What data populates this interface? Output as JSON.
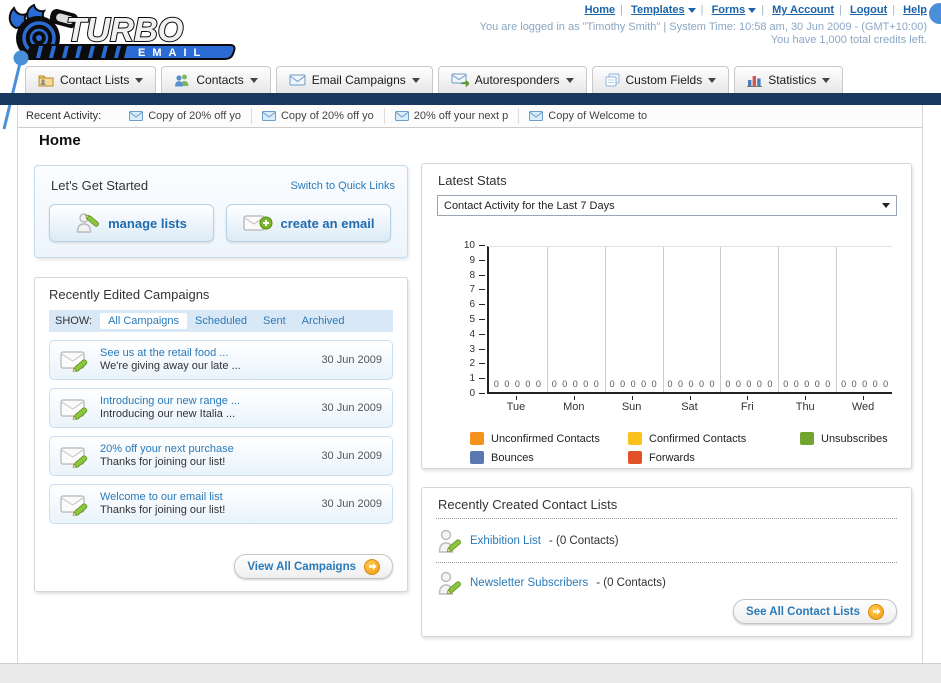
{
  "brand": {
    "name": "TURBO",
    "sub": "EMAIL"
  },
  "header": {
    "links": [
      {
        "label": "Home",
        "dropdown": false
      },
      {
        "label": "Templates",
        "dropdown": true
      },
      {
        "label": "Forms",
        "dropdown": true
      },
      {
        "label": "My Account",
        "dropdown": false
      },
      {
        "label": "Logout",
        "dropdown": false
      },
      {
        "label": "Help",
        "dropdown": false
      }
    ],
    "login_info": "You are logged in as \"Timothy Smith\" | System Time: 10:58 am, 30 Jun 2009 - (GMT+10:00)",
    "credits_info": "You have 1,000 total credits left."
  },
  "nav_tabs": [
    {
      "label": "Contact Lists"
    },
    {
      "label": "Contacts"
    },
    {
      "label": "Email Campaigns"
    },
    {
      "label": "Autoresponders"
    },
    {
      "label": "Custom Fields"
    },
    {
      "label": "Statistics"
    }
  ],
  "recent_activity": {
    "label": "Recent Activity:",
    "items": [
      "Copy of 20% off yo",
      "Copy of 20% off yo",
      "20% off your next p",
      "Copy of Welcome to"
    ]
  },
  "page": {
    "title": "Home"
  },
  "get_started": {
    "title": "Let's Get Started",
    "switch_link": "Switch to Quick Links",
    "buttons": [
      {
        "label": "manage lists"
      },
      {
        "label": "create an email"
      }
    ]
  },
  "campaigns": {
    "title": "Recently Edited Campaigns",
    "show_label": "SHOW:",
    "filters": [
      "All Campaigns",
      "Scheduled",
      "Sent",
      "Archived"
    ],
    "active_filter": "All Campaigns",
    "items": [
      {
        "title": "See us at the retail food ...",
        "subtitle": "We're giving away our late ...",
        "date": "30 Jun 2009"
      },
      {
        "title": "Introducing our new range ...",
        "subtitle": "Introducing our new Italia ...",
        "date": "30 Jun 2009"
      },
      {
        "title": "20% off your next purchase",
        "subtitle": "Thanks for joining our list!",
        "date": "30 Jun 2009"
      },
      {
        "title": "Welcome to our email list",
        "subtitle": "Thanks for joining our list!",
        "date": "30 Jun 2009"
      }
    ],
    "view_all_label": "View All Campaigns"
  },
  "stats": {
    "title": "Latest Stats",
    "selected_option": "Contact Activity for the Last 7 Days"
  },
  "chart_data": {
    "type": "bar",
    "title": "Contact Activity for the Last 7 Days",
    "categories": [
      "Tue",
      "Mon",
      "Sun",
      "Sat",
      "Fri",
      "Thu",
      "Wed"
    ],
    "series": [
      {
        "name": "Unconfirmed Contacts",
        "color": "#f5921e",
        "values": [
          0,
          0,
          0,
          0,
          0,
          0,
          0
        ]
      },
      {
        "name": "Confirmed Contacts",
        "color": "#fcc21c",
        "values": [
          0,
          0,
          0,
          0,
          0,
          0,
          0
        ]
      },
      {
        "name": "Unsubscribes",
        "color": "#71a530",
        "values": [
          0,
          0,
          0,
          0,
          0,
          0,
          0
        ]
      },
      {
        "name": "Bounces",
        "color": "#5b78b0",
        "values": [
          0,
          0,
          0,
          0,
          0,
          0,
          0
        ]
      },
      {
        "name": "Forwards",
        "color": "#e2512a",
        "values": [
          0,
          0,
          0,
          0,
          0,
          0,
          0
        ]
      }
    ],
    "ylim": [
      0,
      10
    ],
    "y_ticks": [
      0,
      1,
      2,
      3,
      4,
      5,
      6,
      7,
      8,
      9,
      10
    ],
    "grid": "vertical",
    "legend_position": "bottom",
    "xlabel": "",
    "ylabel": ""
  },
  "contact_lists": {
    "title": "Recently Created Contact Lists",
    "items": [
      {
        "name": "Exhibition List",
        "suffix": " - (0 Contacts)"
      },
      {
        "name": "Newsletter Subscribers",
        "suffix": " - (0 Contacts)"
      }
    ],
    "see_all_label": "See All Contact Lists"
  }
}
